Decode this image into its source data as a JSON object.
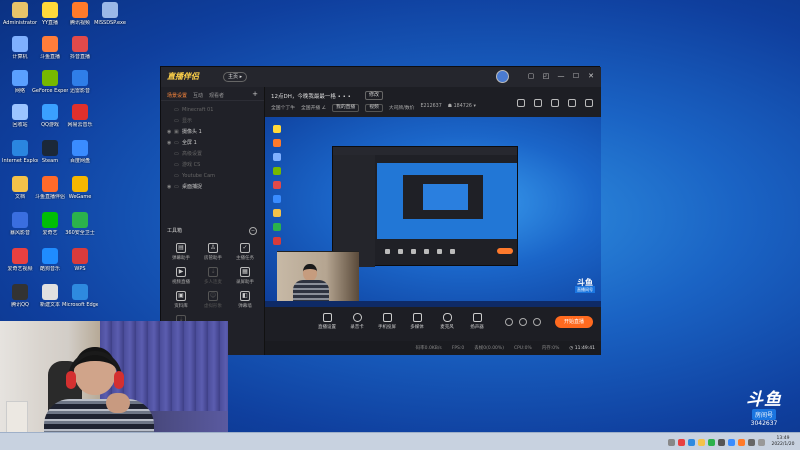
{
  "desktop": {
    "icons": [
      {
        "label": "Administrator",
        "color": "#e8c46a"
      },
      {
        "label": "YY直播",
        "color": "#ffd93a"
      },
      {
        "label": "腾讯视频",
        "color": "#ff7a2a"
      },
      {
        "label": "MISSDSP.exe",
        "color": "#9ab8e8"
      },
      {
        "label": "计算机",
        "color": "#7fb0ff"
      },
      {
        "label": "斗鱼直播",
        "color": "#ff7d3a"
      },
      {
        "label": "抖音直播",
        "color": "#e14a4a"
      },
      {
        "label": "网络",
        "color": "#5aa0ff"
      },
      {
        "label": "GeForce Experience",
        "color": "#76b900"
      },
      {
        "label": "迅雷影音",
        "color": "#2f7ee8"
      },
      {
        "label": "回收站",
        "color": "#9cc4ff"
      },
      {
        "label": "QQ游戏",
        "color": "#3aa0ff"
      },
      {
        "label": "网易云音乐",
        "color": "#e0302c"
      },
      {
        "label": "Internet Explorer",
        "color": "#2a86e0"
      },
      {
        "label": "Steam",
        "color": "#1b2838"
      },
      {
        "label": "百度网盘",
        "color": "#3a8cff"
      },
      {
        "label": "文档",
        "color": "#f4c24a"
      },
      {
        "label": "斗鱼直播伴侣",
        "color": "#ff6a2a"
      },
      {
        "label": "WeGame",
        "color": "#f5b700"
      },
      {
        "label": "暴风影音",
        "color": "#3a6edf"
      },
      {
        "label": "爱奇艺",
        "color": "#00be06"
      },
      {
        "label": "360安全卫士",
        "color": "#2bb24c"
      },
      {
        "label": "爱奇艺视频",
        "color": "#e84040"
      },
      {
        "label": "酷狗音乐",
        "color": "#1f8cff"
      },
      {
        "label": "WPS",
        "color": "#d83b3b"
      },
      {
        "label": "腾讯QQ",
        "color": "#333333"
      },
      {
        "label": "新建文本",
        "color": "#e0e0e0"
      },
      {
        "label": "Microsoft Edge",
        "color": "#2e8adf"
      }
    ]
  },
  "app": {
    "logo": "直播伴侣",
    "brand_button": "主页 ▸",
    "window_controls": [
      "▢",
      "◰",
      "—",
      "☐",
      "✕"
    ],
    "sidebar_tabs": {
      "active": "场景设置",
      "t2": "互动",
      "t3": "观看者"
    },
    "scenes": [
      {
        "name": "Minecraft 01",
        "on": false,
        "eye": "",
        "type": "▭"
      },
      {
        "name": "显示",
        "on": false,
        "eye": "",
        "type": "▭"
      },
      {
        "name": "摄像头 1",
        "on": true,
        "eye": "◉",
        "type": "▣"
      },
      {
        "name": "全屏 1",
        "on": true,
        "eye": "◉",
        "type": "▭"
      },
      {
        "name": "高级设置",
        "on": false,
        "eye": "",
        "type": "▭"
      },
      {
        "name": "游戏 CS",
        "on": false,
        "eye": "",
        "type": "▭"
      },
      {
        "name": "Youtube Cam",
        "on": false,
        "eye": "",
        "type": "▭"
      },
      {
        "name": "桌面捕捉",
        "on": true,
        "eye": "◉",
        "type": "▭"
      }
    ],
    "tools_label": "工具箱",
    "tools_collapse": "−",
    "tools": [
      {
        "label": "弹幕助手",
        "icon": "▤",
        "dim": false
      },
      {
        "label": "房管助手",
        "icon": "♙",
        "dim": false
      },
      {
        "label": "主播任务",
        "icon": "✓",
        "dim": false
      },
      {
        "label": "视频直播",
        "icon": "▶",
        "dim": false
      },
      {
        "label": "多人连麦",
        "icon": "⇣",
        "dim": true
      },
      {
        "label": "录屏助手",
        "icon": "▦",
        "dim": false
      },
      {
        "label": "资料库",
        "icon": "▣",
        "dim": false
      },
      {
        "label": "虚拟形象",
        "icon": "☺",
        "dim": true
      },
      {
        "label": "弹幕墙",
        "icon": "◧",
        "dim": false
      },
      {
        "label": "",
        "icon": "⇣",
        "dim": true
      }
    ],
    "room": {
      "title": "12点DH，今晚我最最一格 • • •",
      "edit": "修改",
      "sub": [
        "全国个丁牛",
        "全国开播 ∠",
        "我的直播",
        "视频",
        "大司牌/数价",
        "E212637",
        "☗ 184726 ▾"
      ]
    },
    "controls": [
      {
        "label": "直播设置"
      },
      {
        "label": "录音卡"
      },
      {
        "label": "手机投屏"
      },
      {
        "label": "多媒体"
      },
      {
        "label": "麦克风"
      },
      {
        "label": "扬声器"
      }
    ],
    "live_button": "开始直播",
    "status": {
      "bitrate": "码率0.0KB/s",
      "fps": "FPS:0",
      "drop": "丢帧0(0.00%)",
      "cpu": "CPU:0%",
      "mem": "内存:0%",
      "time": "◷ 11:49:41"
    },
    "preview_watermark": {
      "big": "斗鱼",
      "small": "直播间号"
    }
  },
  "watermark": {
    "big": "斗鱼",
    "room_label": "房间号",
    "room_number": "3042637"
  },
  "taskbar": {
    "clock_time": "13:49",
    "clock_date": "2022/1/20",
    "tray_colors": [
      "#888888",
      "#e84040",
      "#2e8adf",
      "#f4c24a",
      "#2bb24c",
      "#555555",
      "#3a8cff",
      "#ff7a2a",
      "#666666",
      "#999999"
    ]
  }
}
